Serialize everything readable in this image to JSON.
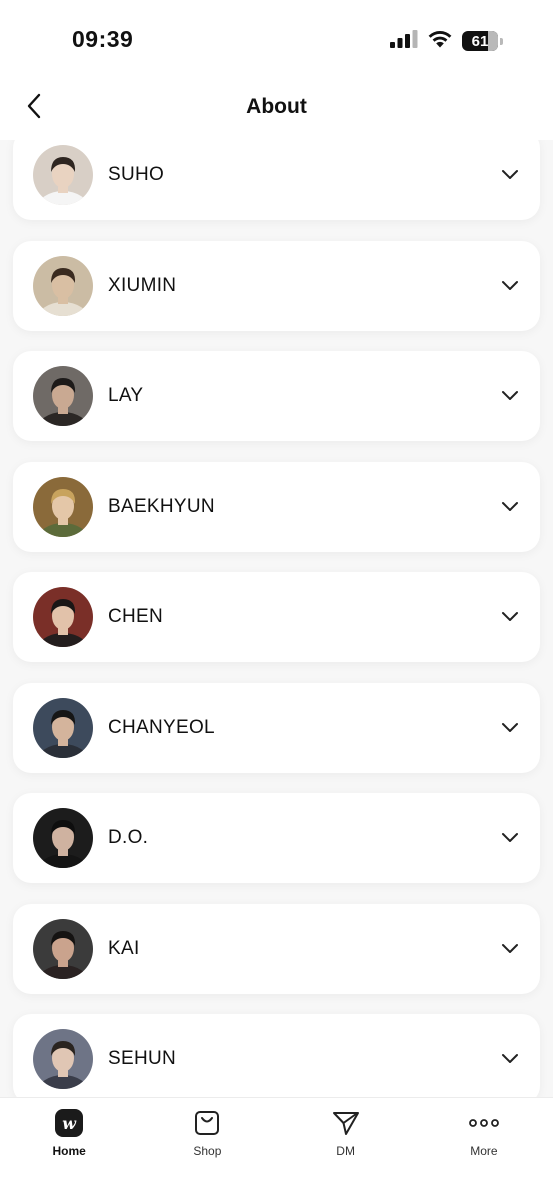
{
  "status_bar": {
    "time": "09:39",
    "battery": "61"
  },
  "header": {
    "title": "About"
  },
  "members": [
    {
      "name": "SUHO",
      "avatar": {
        "bg": "#d8cfc6",
        "skin": "#e9d3c1",
        "hair": "#2e2520",
        "cloth": "#f5f5f5"
      }
    },
    {
      "name": "XIUMIN",
      "avatar": {
        "bg": "#cbbca4",
        "skin": "#d9bfa3",
        "hair": "#3a2b20",
        "cloth": "#e6dfd2"
      }
    },
    {
      "name": "LAY",
      "avatar": {
        "bg": "#6f6a66",
        "skin": "#c9a992",
        "hair": "#1d1a19",
        "cloth": "#2b2725"
      }
    },
    {
      "name": "BAEKHYUN",
      "avatar": {
        "bg": "#8a6a3a",
        "skin": "#e4c7a8",
        "hair": "#c8a35d",
        "cloth": "#5c6b3a"
      }
    },
    {
      "name": "CHEN",
      "avatar": {
        "bg": "#7a2f28",
        "skin": "#e2c2aa",
        "hair": "#1a1616",
        "cloth": "#231d1d"
      }
    },
    {
      "name": "CHANYEOL",
      "avatar": {
        "bg": "#3d4a5c",
        "skin": "#d4b49c",
        "hair": "#161616",
        "cloth": "#2a2f38"
      }
    },
    {
      "name": "D.O.",
      "avatar": {
        "bg": "#1c1c1c",
        "skin": "#cfb2a0",
        "hair": "#0e0e0e",
        "cloth": "#141414"
      }
    },
    {
      "name": "KAI",
      "avatar": {
        "bg": "#3b3b3b",
        "skin": "#caa38d",
        "hair": "#151312",
        "cloth": "#2a2222"
      }
    },
    {
      "name": "SEHUN",
      "avatar": {
        "bg": "#6e7486",
        "skin": "#e0c6b4",
        "hair": "#2a2420",
        "cloth": "#3a3d4a"
      }
    }
  ],
  "tab_bar": {
    "tabs": [
      {
        "label": "Home",
        "icon": "weverse-logo-icon",
        "active": true
      },
      {
        "label": "Shop",
        "icon": "shopping-bag-icon",
        "active": false
      },
      {
        "label": "DM",
        "icon": "paper-plane-icon",
        "active": false
      },
      {
        "label": "More",
        "icon": "ellipsis-icon",
        "active": false
      }
    ]
  },
  "colors": {
    "card_bg": "#ffffff",
    "list_bg": "#f7f7f7",
    "text": "#111111"
  }
}
